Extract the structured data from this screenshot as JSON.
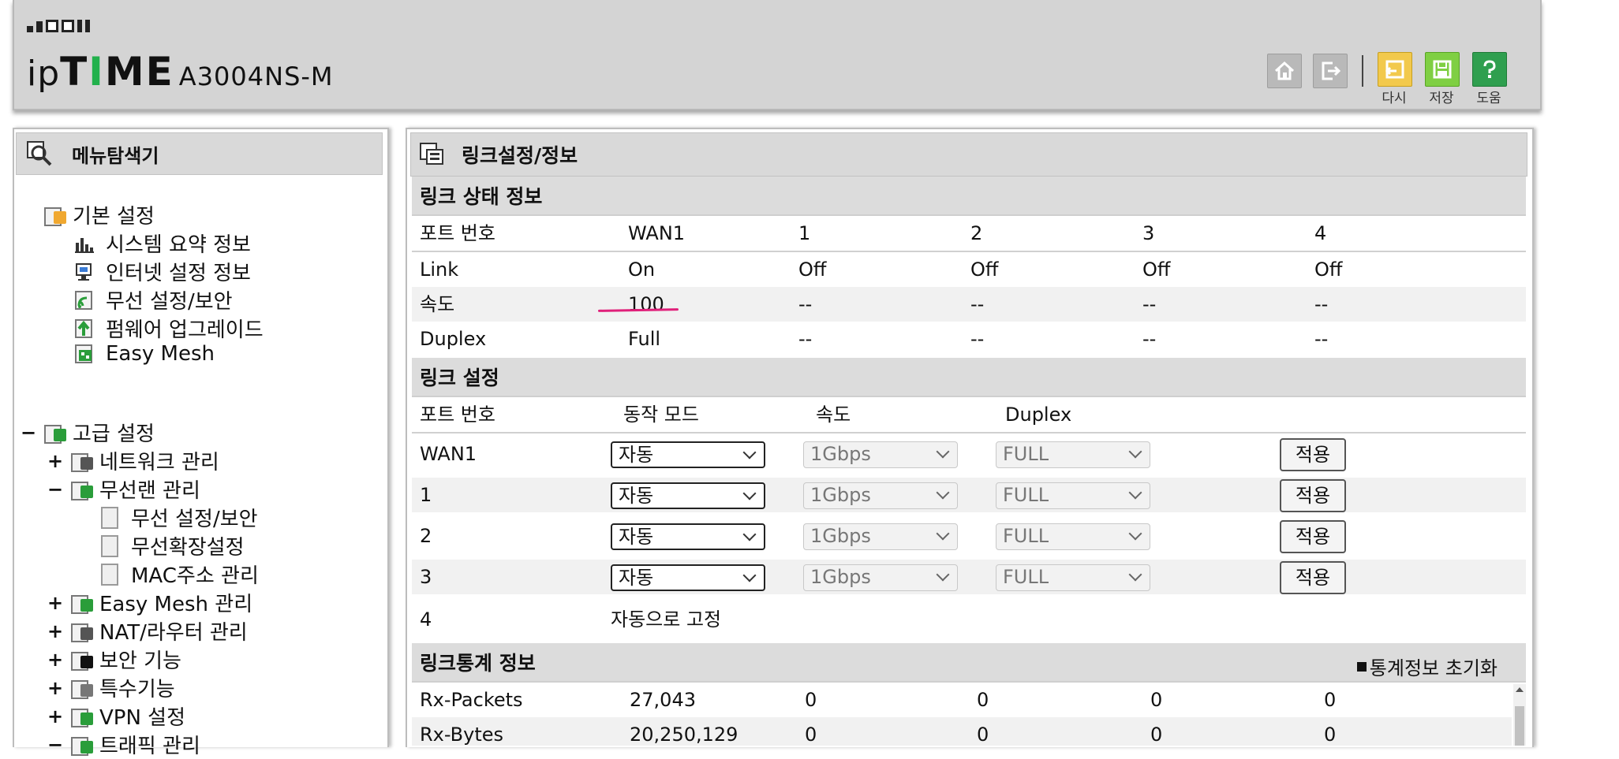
{
  "header": {
    "brand_ip": "ip",
    "brand_t": "T",
    "brand_i": "I",
    "brand_me": "ME",
    "model": "A3004NS-M",
    "buttons": [
      {
        "icon": "home-icon",
        "label": ""
      },
      {
        "icon": "logout-icon",
        "label": ""
      },
      {
        "icon": "back-icon",
        "label": "다시"
      },
      {
        "icon": "save-icon",
        "label": "저장"
      },
      {
        "icon": "help-icon",
        "label": "도움"
      }
    ]
  },
  "menu": {
    "title": "메뉴탐색기",
    "basic": {
      "label": "기본 설정",
      "items": [
        "시스템 요약 정보",
        "인터넷 설정 정보",
        "무선 설정/보안",
        "펌웨어 업그레이드",
        "Easy Mesh"
      ]
    },
    "advanced": {
      "toggle": "−",
      "label": "고급 설정",
      "items": [
        {
          "toggle": "+",
          "label": "네트워크 관리"
        },
        {
          "toggle": "−",
          "label": "무선랜 관리"
        },
        {
          "toggle": "",
          "label": "무선 설정/보안"
        },
        {
          "toggle": "",
          "label": "무선확장설정"
        },
        {
          "toggle": "",
          "label": "MAC주소 관리"
        },
        {
          "toggle": "+",
          "label": "Easy Mesh 관리"
        },
        {
          "toggle": "+",
          "label": "NAT/라우터 관리"
        },
        {
          "toggle": "+",
          "label": "보안 기능"
        },
        {
          "toggle": "+",
          "label": "특수기능"
        },
        {
          "toggle": "+",
          "label": "VPN 설정"
        },
        {
          "toggle": "−",
          "label": "트래픽 관리"
        }
      ]
    }
  },
  "content": {
    "title": "링크설정/정보",
    "status": {
      "section": "링크 상태 정보",
      "headers": [
        "포트 번호",
        "WAN1",
        "1",
        "2",
        "3",
        "4"
      ],
      "rows": [
        [
          "Link",
          "On",
          "Off",
          "Off",
          "Off",
          "Off"
        ],
        [
          "속도",
          "100",
          "--",
          "--",
          "--",
          "--"
        ],
        [
          "Duplex",
          "Full",
          "--",
          "--",
          "--",
          "--"
        ]
      ]
    },
    "settings": {
      "section": "링크 설정",
      "headers": [
        "포트 번호",
        "동작 모드",
        "속도",
        "Duplex"
      ],
      "rows": [
        {
          "port": "WAN1",
          "mode": "자동",
          "speed": "1Gbps",
          "duplex": "FULL",
          "apply": "적용"
        },
        {
          "port": "1",
          "mode": "자동",
          "speed": "1Gbps",
          "duplex": "FULL",
          "apply": "적용"
        },
        {
          "port": "2",
          "mode": "자동",
          "speed": "1Gbps",
          "duplex": "FULL",
          "apply": "적용"
        },
        {
          "port": "3",
          "mode": "자동",
          "speed": "1Gbps",
          "duplex": "FULL",
          "apply": "적용"
        }
      ],
      "fixed_row": {
        "port": "4",
        "text": "자동으로 고정"
      }
    },
    "stats": {
      "section": "링크통계 정보",
      "reset_label": "통계정보 초기화",
      "rows": [
        [
          "Rx-Packets",
          "27,043",
          "0",
          "0",
          "0",
          "0"
        ],
        [
          "Rx-Bytes",
          "20,250,129",
          "0",
          "0",
          "0",
          "0"
        ]
      ]
    }
  }
}
